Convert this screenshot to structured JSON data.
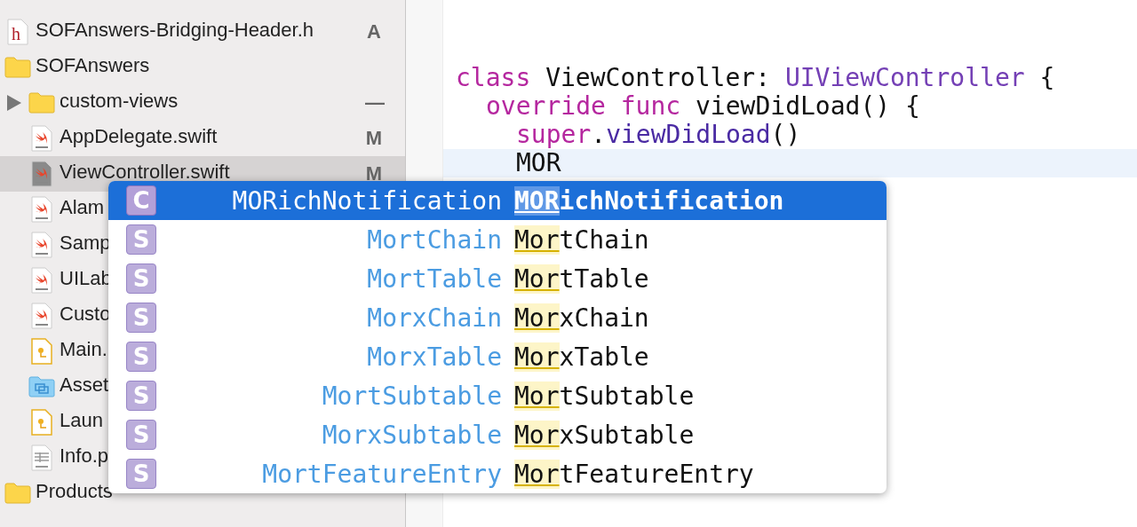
{
  "sidebar": {
    "items": [
      {
        "name": "SOFAnswers-Bridging-Header.h",
        "kind": "header",
        "glyph": "h",
        "status": "A",
        "selected": false
      },
      {
        "name": "SOFAnswers",
        "kind": "folder",
        "selected": false,
        "children": [
          {
            "name": "custom-views",
            "kind": "folder",
            "expanded": false,
            "status": "—",
            "selected": false
          },
          {
            "name": "AppDelegate.swift",
            "kind": "swift",
            "status": "M",
            "selected": false
          },
          {
            "name": "ViewController.swift",
            "kind": "swift",
            "status": "M",
            "selected": true
          },
          {
            "name": "Alam",
            "kind": "swift",
            "selected": false
          },
          {
            "name": "Samp",
            "kind": "swift",
            "selected": false
          },
          {
            "name": "UILab",
            "kind": "swift",
            "selected": false
          },
          {
            "name": "Custo",
            "kind": "swift",
            "selected": false
          },
          {
            "name": "Main.",
            "kind": "storyboard",
            "selected": false
          },
          {
            "name": "Asset",
            "kind": "assets",
            "selected": false
          },
          {
            "name": "Laun",
            "kind": "storyboard",
            "selected": false
          },
          {
            "name": "Info.p",
            "kind": "plist",
            "selected": false
          }
        ]
      },
      {
        "name": "Products",
        "kind": "folder",
        "selected": false
      }
    ]
  },
  "editor": {
    "lines": [
      {
        "current": false,
        "tokens": [
          {
            "kind": "keyword",
            "text": "class"
          },
          {
            "kind": "plain",
            "text": " ViewController: "
          },
          {
            "kind": "type",
            "text": "UIViewController"
          },
          {
            "kind": "plain",
            "text": " {"
          }
        ],
        "children": [
          {
            "current": false,
            "tokens": [
              {
                "kind": "keyword",
                "text": "override func"
              },
              {
                "kind": "plain",
                "text": " viewDidLoad() {"
              }
            ],
            "children": [
              {
                "current": false,
                "tokens": [
                  {
                    "kind": "keyword",
                    "text": "super"
                  },
                  {
                    "kind": "plain",
                    "text": "."
                  },
                  {
                    "kind": "call",
                    "text": "viewDidLoad"
                  },
                  {
                    "kind": "plain",
                    "text": "()"
                  }
                ]
              },
              {
                "current": true,
                "tokens": [
                  {
                    "kind": "plain",
                    "text": "MOR"
                  }
                ]
              }
            ]
          }
        ]
      }
    ]
  },
  "completions": [
    {
      "kind": "class",
      "badge": "C",
      "type": "MORichNotification",
      "match": "MOR",
      "rest": "ichNotification",
      "selected": true
    },
    {
      "kind": "struct",
      "badge": "S",
      "type": "MortChain",
      "match": "Mor",
      "rest": "tChain",
      "selected": false
    },
    {
      "kind": "struct",
      "badge": "S",
      "type": "MortTable",
      "match": "Mor",
      "rest": "tTable",
      "selected": false
    },
    {
      "kind": "struct",
      "badge": "S",
      "type": "MorxChain",
      "match": "Mor",
      "rest": "xChain",
      "selected": false
    },
    {
      "kind": "struct",
      "badge": "S",
      "type": "MorxTable",
      "match": "Mor",
      "rest": "xTable",
      "selected": false
    },
    {
      "kind": "struct",
      "badge": "S",
      "type": "MortSubtable",
      "match": "Mor",
      "rest": "tSubtable",
      "selected": false
    },
    {
      "kind": "struct",
      "badge": "S",
      "type": "MorxSubtable",
      "match": "Mor",
      "rest": "xSubtable",
      "selected": false
    },
    {
      "kind": "struct",
      "badge": "S",
      "type": "MortFeatureEntry",
      "match": "Mor",
      "rest": "tFeatureEntry",
      "selected": false
    }
  ]
}
